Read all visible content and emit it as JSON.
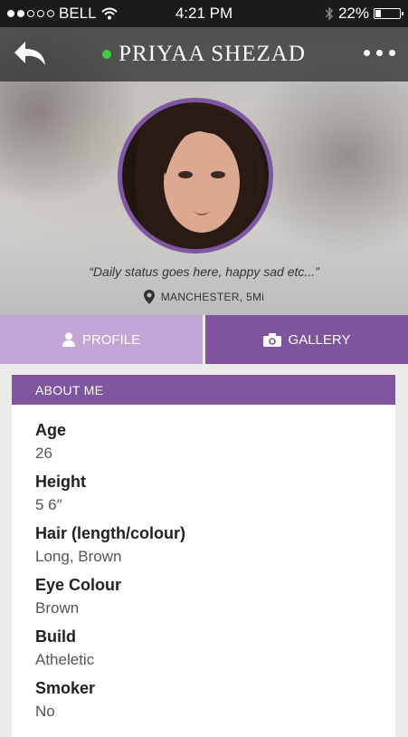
{
  "statusbar": {
    "carrier": "BELL",
    "time": "4:21 PM",
    "battery": "22%",
    "battery_level": 0.22,
    "signal_bars_filled": 2,
    "signal_bars_total": 5
  },
  "header": {
    "name": "PRIYAA SHEZAD",
    "online_color": "#3ed13e",
    "status_text": "“Daily status goes here, happy sad etc...”",
    "location": "MANCHESTER, 5Mi"
  },
  "tabs": [
    {
      "label": "PROFILE",
      "icon": "person-icon"
    },
    {
      "label": "GALLERY",
      "icon": "camera-icon"
    }
  ],
  "about": {
    "title": "ABOUT ME",
    "fields": [
      {
        "label": "Age",
        "value": "26"
      },
      {
        "label": "Height",
        "value": "5 6″"
      },
      {
        "label": "Hair (length/colour)",
        "value": "Long, Brown"
      },
      {
        "label": "Eye Colour",
        "value": "Brown"
      },
      {
        "label": "Build",
        "value": "Atheletic"
      },
      {
        "label": "Smoker",
        "value": "No"
      }
    ]
  },
  "colors": {
    "accent": "#7f569e",
    "tab_active": "#c4a6d6",
    "tab_inactive": "#7e549c"
  }
}
